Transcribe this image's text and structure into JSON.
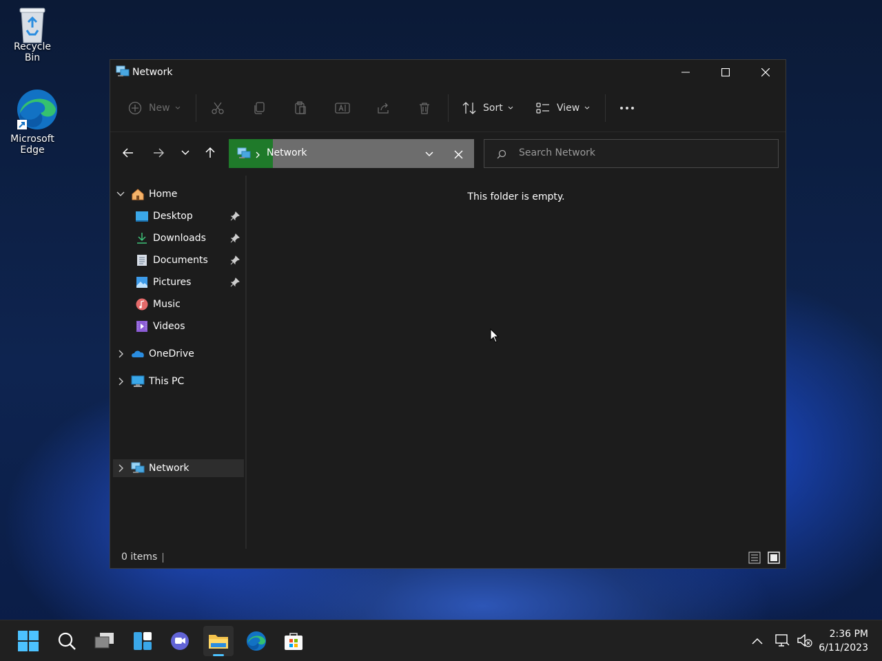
{
  "desktop": {
    "icons": [
      {
        "label": "Recycle Bin",
        "icon": "recycle-bin-icon"
      },
      {
        "label": "Microsoft Edge",
        "icon": "edge-icon"
      }
    ]
  },
  "window": {
    "title": "Network",
    "controls": {
      "minimize": "minimize-icon",
      "maximize": "maximize-icon",
      "close": "close-icon"
    }
  },
  "toolbar": {
    "new_label": "New",
    "sort_label": "Sort",
    "view_label": "View"
  },
  "address": {
    "path_label": "Network",
    "search_placeholder": "Search Network"
  },
  "sidebar": {
    "home": "Home",
    "items": [
      {
        "label": "Desktop",
        "pinned": true
      },
      {
        "label": "Downloads",
        "pinned": true
      },
      {
        "label": "Documents",
        "pinned": true
      },
      {
        "label": "Pictures",
        "pinned": true
      },
      {
        "label": "Music",
        "pinned": false
      },
      {
        "label": "Videos",
        "pinned": false
      }
    ],
    "onedrive": "OneDrive",
    "thispc": "This PC",
    "network": "Network"
  },
  "content": {
    "empty_message": "This folder is empty."
  },
  "status": {
    "item_count": "0 items"
  },
  "taskbar": {
    "time": "2:36 PM",
    "date": "6/11/2023"
  },
  "colors": {
    "accent": "#4cc2ff",
    "window_bg": "#1c1c1c",
    "taskbar_bg": "#202020"
  }
}
